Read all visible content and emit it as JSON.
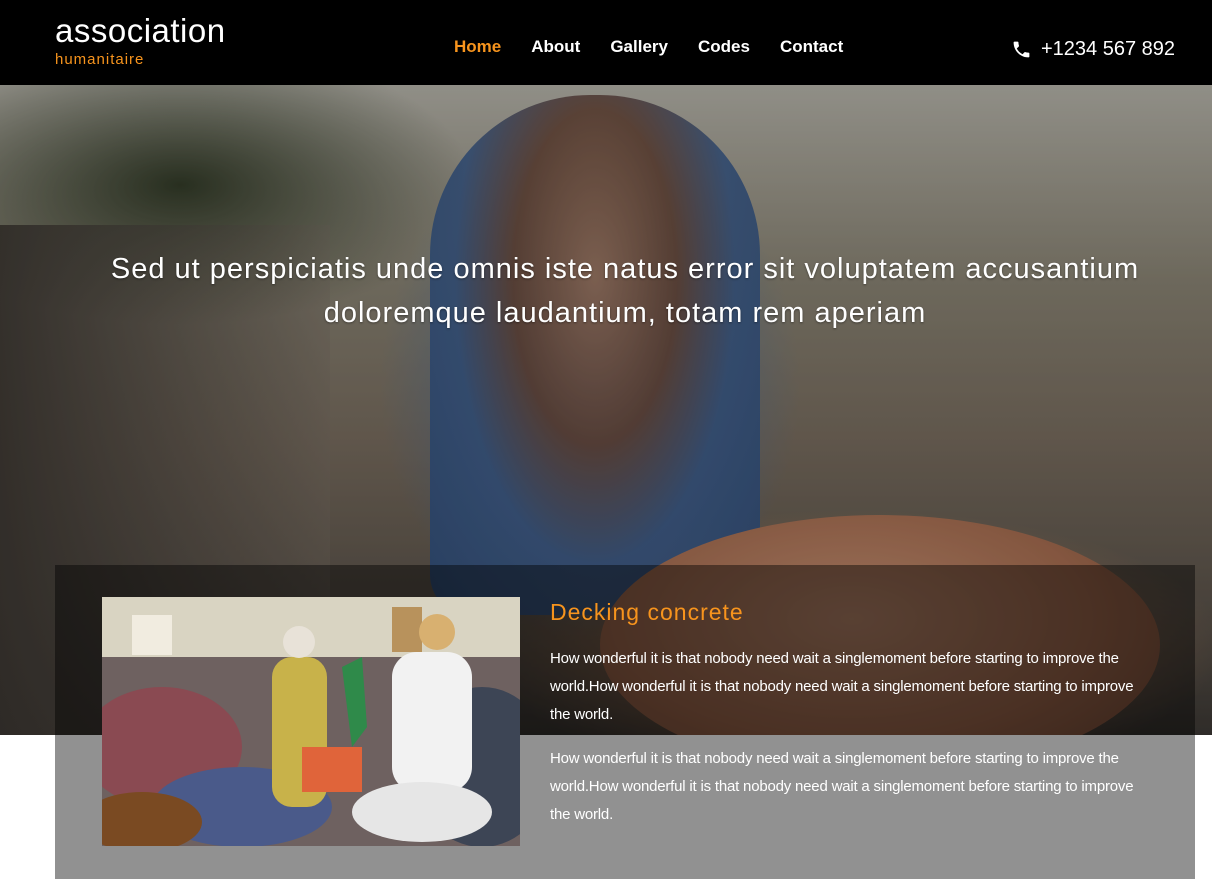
{
  "header": {
    "logo_title": "association",
    "logo_subtitle": "humanitaire",
    "nav": [
      {
        "label": "Home",
        "active": true
      },
      {
        "label": "About",
        "active": false
      },
      {
        "label": "Gallery",
        "active": false
      },
      {
        "label": "Codes",
        "active": false
      },
      {
        "label": "Contact",
        "active": false
      }
    ],
    "phone_icon": "phone-icon",
    "phone": "+1234 567 892"
  },
  "hero": {
    "line1": "Sed ut perspiciatis unde omnis iste natus error sit voluptatem accusantium",
    "line2": "doloremque laudantium, totam rem aperiam"
  },
  "feature": {
    "title": "Decking concrete",
    "paragraph1": "How wonderful it is that nobody need wait a singlemoment before starting to improve the world.How wonderful it is that nobody need wait a singlemoment before starting to improve the world.",
    "paragraph2": "How wonderful it is that nobody need wait a singlemoment before starting to improve the world.How wonderful it is that nobody need wait a singlemoment before starting to improve the world."
  },
  "colors": {
    "accent": "#f7941d",
    "header_bg": "#000000"
  }
}
